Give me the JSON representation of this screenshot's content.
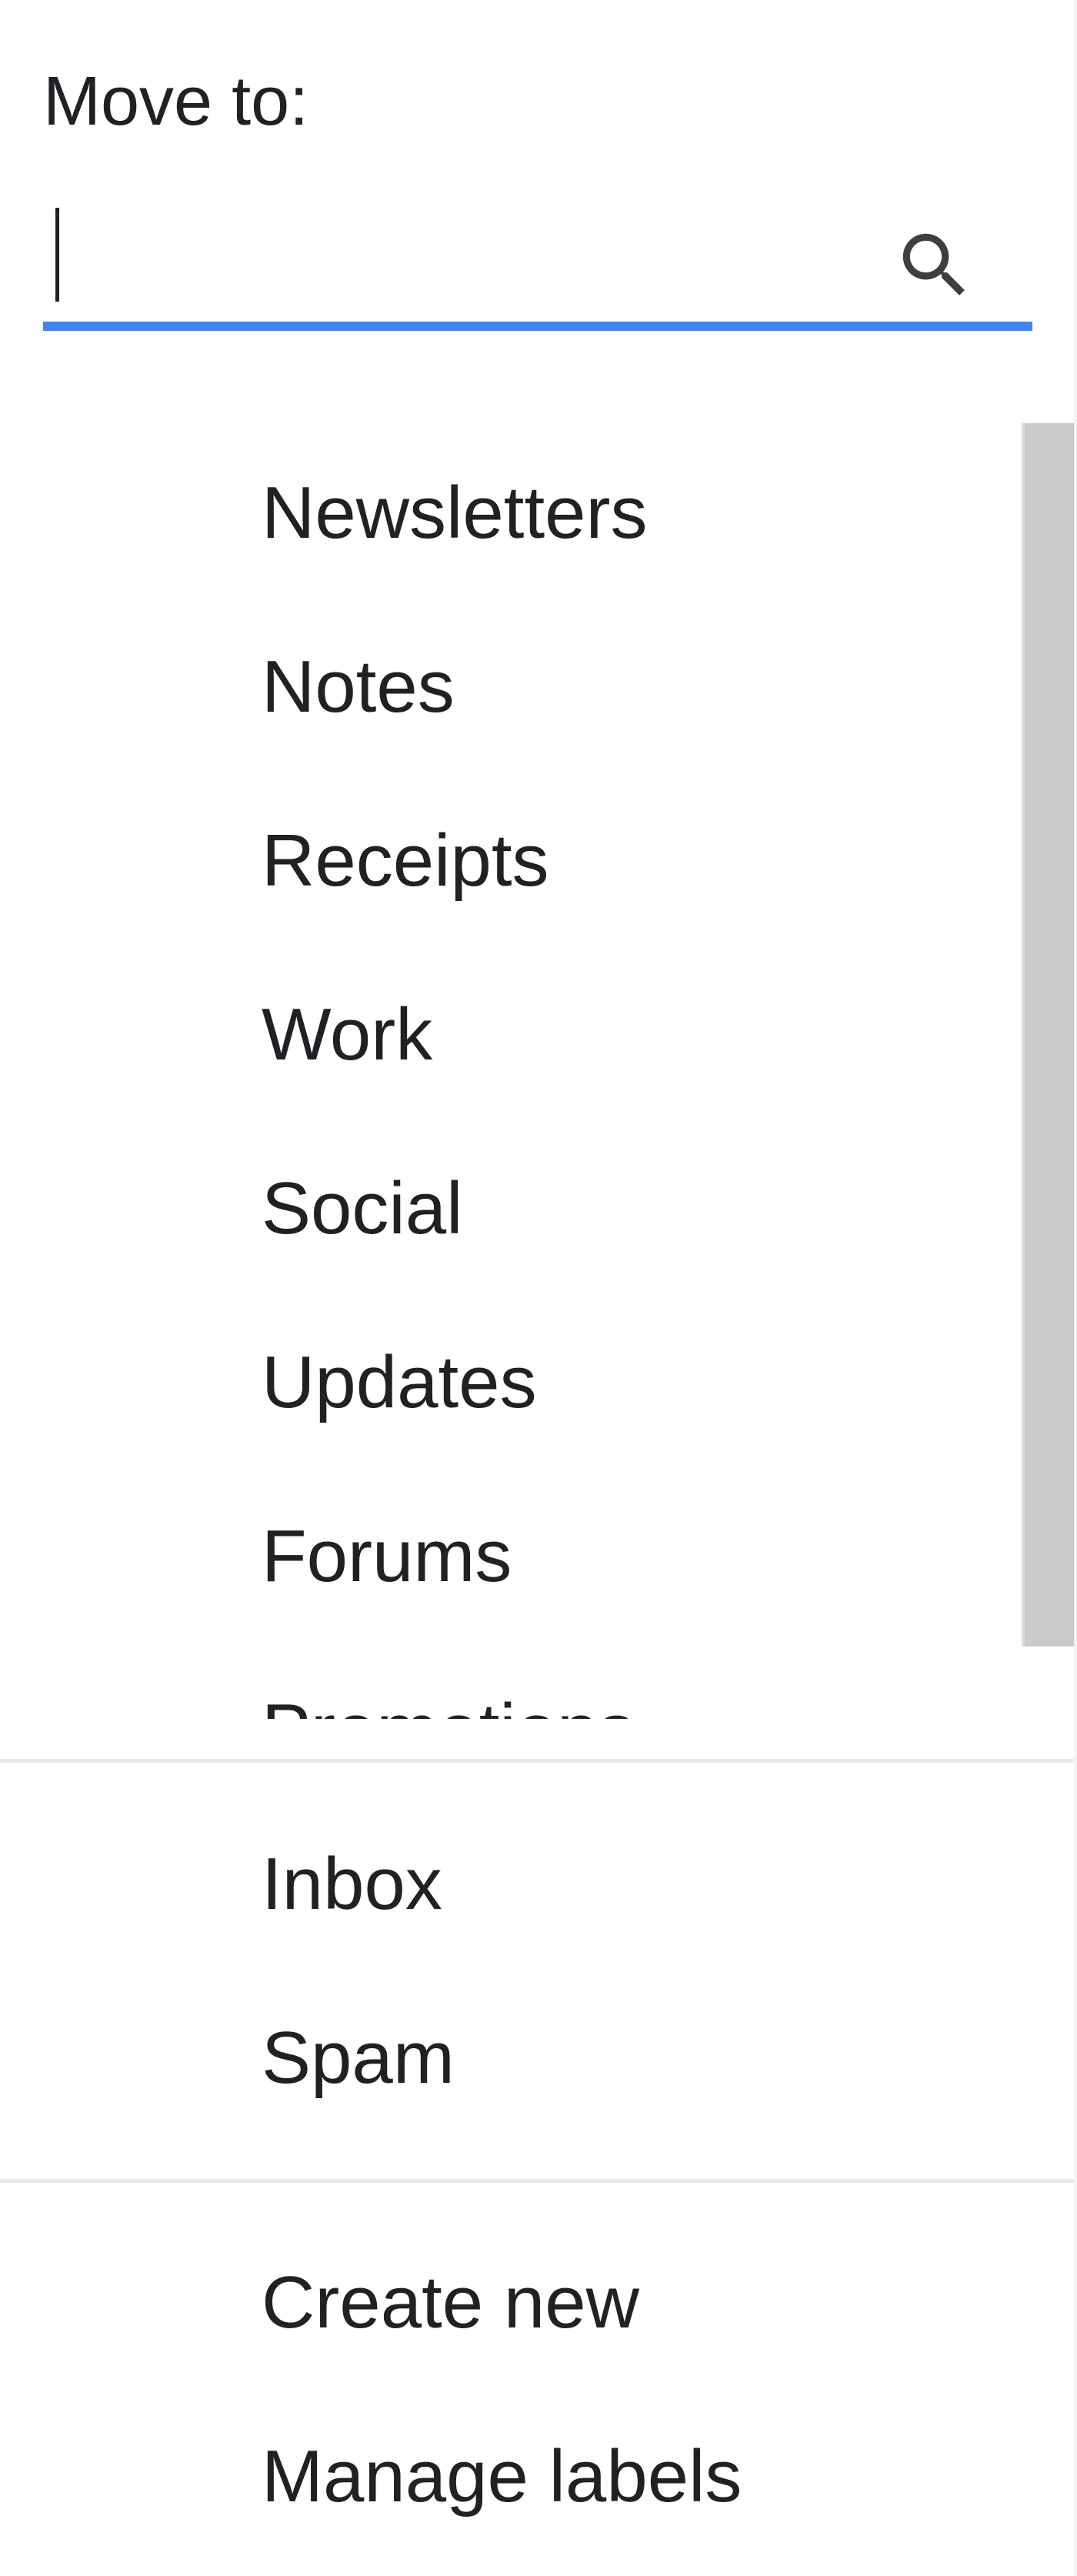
{
  "dialog": {
    "title": "Move to:"
  },
  "search": {
    "value": "",
    "placeholder": "",
    "icon": "search-icon"
  },
  "labels": [
    {
      "label": "Newsletters"
    },
    {
      "label": "Notes"
    },
    {
      "label": "Receipts"
    },
    {
      "label": "Work"
    },
    {
      "label": "Social"
    },
    {
      "label": "Updates"
    },
    {
      "label": "Forums"
    },
    {
      "label": "Promotions"
    }
  ],
  "system_folders": [
    {
      "label": "Inbox"
    },
    {
      "label": "Spam"
    }
  ],
  "actions": [
    {
      "label": "Create new"
    },
    {
      "label": "Manage labels"
    }
  ],
  "colors": {
    "accent": "#4285f4",
    "text": "#202124",
    "divider": "#e8eaed",
    "scrollbar": "#cacaca"
  }
}
